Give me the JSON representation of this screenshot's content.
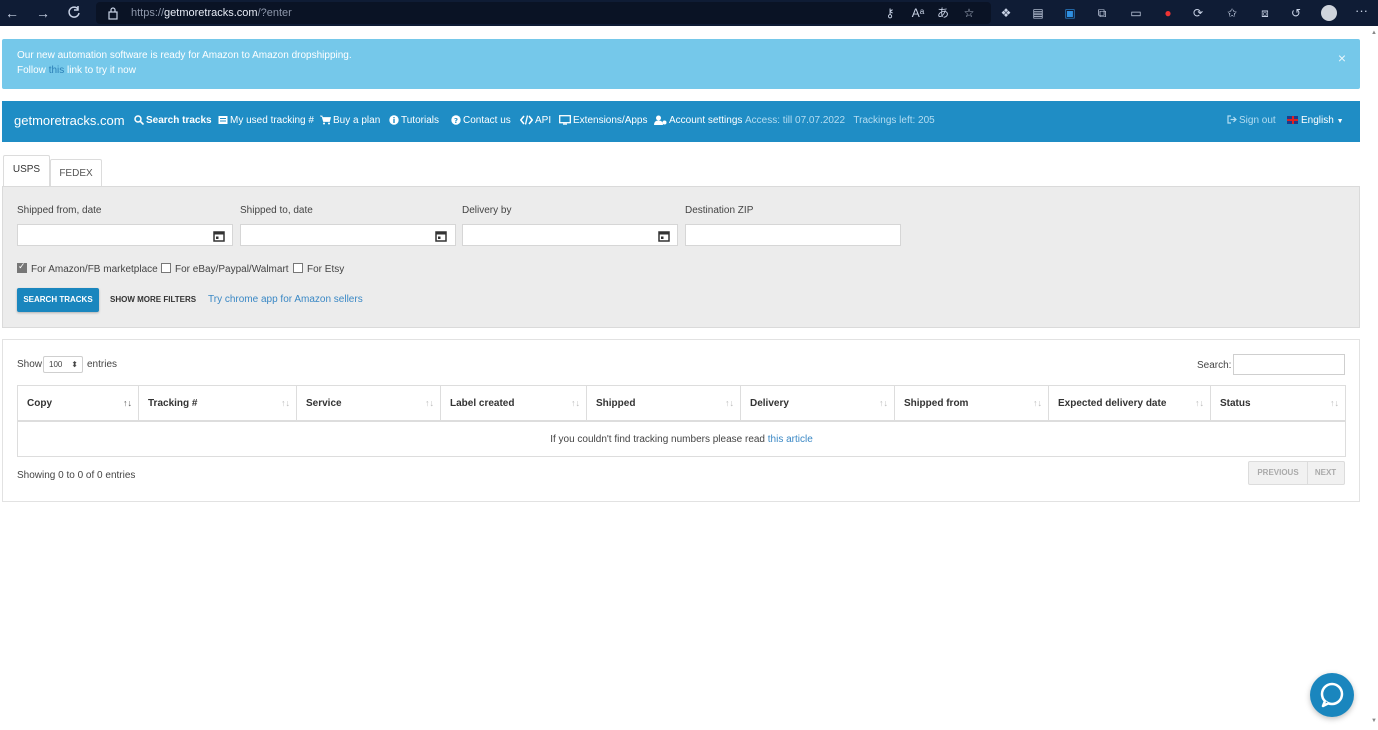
{
  "browser": {
    "url_prefix": "https://",
    "url_host": "getmoretracks.com",
    "url_path": "/?enter",
    "more_label": "···"
  },
  "alert": {
    "line1": "Our new automation software is ready for Amazon to Amazon dropshipping.",
    "follow": "Follow ",
    "link": "this",
    "rest": " link to try it now",
    "close": "×"
  },
  "navbar": {
    "brand": "getmoretracks.com",
    "items": [
      {
        "label": "Search tracks",
        "icon": "search-icon"
      },
      {
        "label": "My used tracking #",
        "icon": "list-icon"
      },
      {
        "label": "Buy a plan",
        "icon": "cart-icon"
      },
      {
        "label": "Tutorials",
        "icon": "info-icon"
      },
      {
        "label": "Contact us",
        "icon": "question-icon"
      },
      {
        "label": "API",
        "icon": "code-icon"
      },
      {
        "label": "Extensions/Apps",
        "icon": "monitor-icon"
      },
      {
        "label": "Account settings",
        "icon": "user-cog-icon"
      }
    ],
    "access": "Access: till 07.07.2022",
    "trackings": "Trackings left: 205",
    "signout": "Sign out",
    "language": "English"
  },
  "tabs": [
    {
      "label": "USPS",
      "active": true
    },
    {
      "label": "FEDEX",
      "active": false
    }
  ],
  "filters": {
    "shipped_from": "Shipped from, date",
    "shipped_to": "Shipped to, date",
    "delivery_by": "Delivery by",
    "destination_zip": "Destination ZIP",
    "checkboxes": [
      {
        "label": "For Amazon/FB marketplace",
        "checked": true
      },
      {
        "label": "For eBay/Paypal/Walmart",
        "checked": false
      },
      {
        "label": "For Etsy",
        "checked": false
      }
    ],
    "search_button": "SEARCH TRACKS",
    "more_filters": "SHOW MORE FILTERS",
    "chrome_link": "Try chrome app for Amazon sellers"
  },
  "results": {
    "show": "Show",
    "page_length": "100",
    "entries": "entries",
    "search_label": "Search:",
    "columns": [
      "Copy",
      "Tracking #",
      "Service",
      "Label created",
      "Shipped",
      "Delivery",
      "Shipped from",
      "Expected delivery date",
      "Status"
    ],
    "empty_text": "If you couldn't find tracking numbers please read ",
    "empty_link": "this article",
    "showing": "Showing 0 to 0 of 0 entries",
    "previous": "PREVIOUS",
    "next": "NEXT"
  },
  "colors": {
    "navbar": "#1f8dc5",
    "alert": "#75c8ea",
    "button": "#1a86be",
    "link": "#3a88c5"
  }
}
